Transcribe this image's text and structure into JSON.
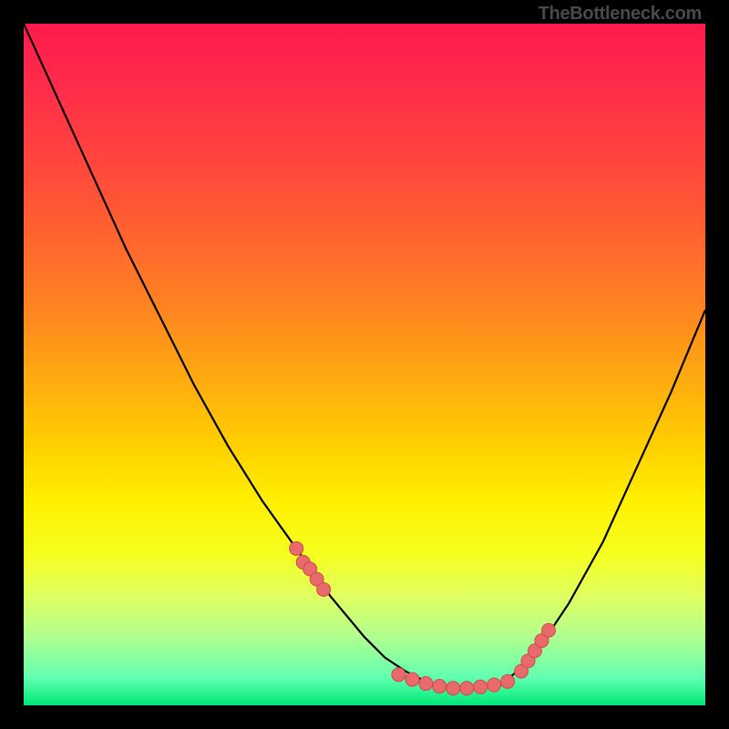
{
  "watermark": "TheBottleneck.com",
  "chart_data": {
    "type": "line",
    "title": "",
    "xlabel": "",
    "ylabel": "",
    "xlim": [
      0,
      100
    ],
    "ylim": [
      0,
      100
    ],
    "series": [
      {
        "name": "curve",
        "x": [
          0,
          5,
          10,
          15,
          20,
          25,
          30,
          35,
          40,
          45,
          50,
          53,
          56,
          58,
          60,
          63,
          66,
          70,
          73,
          76,
          80,
          85,
          90,
          95,
          100
        ],
        "y": [
          100,
          89,
          78,
          67,
          57,
          47,
          38,
          30,
          23,
          16,
          10,
          7,
          5,
          4,
          3,
          2.5,
          2.5,
          3,
          5.5,
          9,
          15,
          24,
          35,
          46,
          58
        ]
      },
      {
        "name": "highlight-points",
        "x": [
          40,
          41,
          42,
          43,
          44,
          55,
          57,
          59,
          61,
          63,
          65,
          67,
          69,
          71,
          73,
          74,
          75,
          76,
          77
        ],
        "y": [
          23,
          21,
          20,
          18.5,
          17,
          4.5,
          3.8,
          3.2,
          2.8,
          2.5,
          2.5,
          2.7,
          3,
          3.5,
          5,
          6.5,
          8,
          9.5,
          11
        ]
      }
    ],
    "colors": {
      "curve": "#000000",
      "points_fill": "#e86a6a",
      "points_stroke": "#d04a4a"
    }
  }
}
